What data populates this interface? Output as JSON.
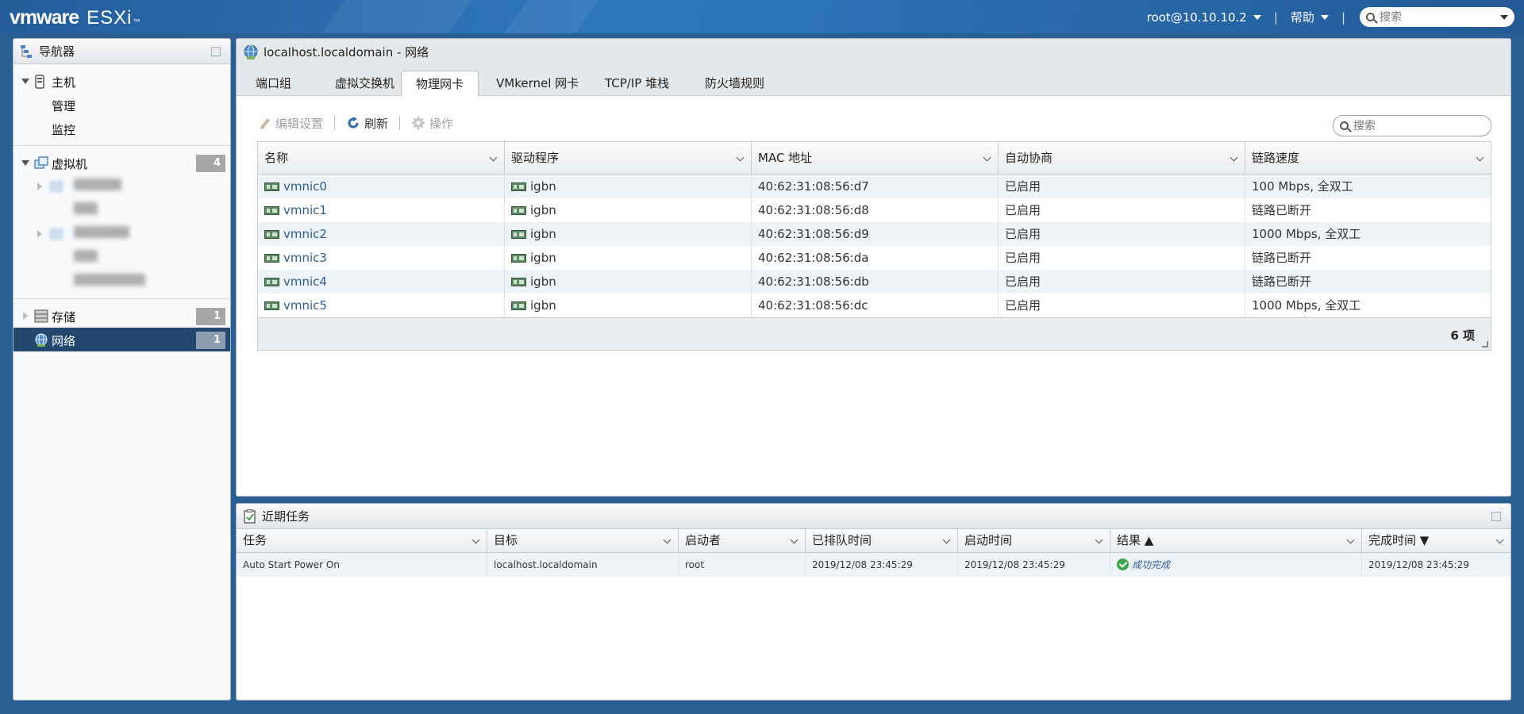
{
  "header": {
    "logo_vm": "vmware",
    "logo_product": "ESXi",
    "logo_tm": "™",
    "user": "root@10.10.10.2",
    "help": "帮助",
    "search_placeholder": "搜索"
  },
  "navigator": {
    "title": "导航器",
    "items": [
      {
        "label": "主机",
        "icon": "host-icon"
      },
      {
        "label": "管理"
      },
      {
        "label": "监控"
      },
      {
        "label": "虚拟机",
        "icon": "vm-icon",
        "badge": "4"
      },
      {
        "label": "存储",
        "icon": "storage-icon",
        "badge": "1"
      },
      {
        "label": "网络",
        "icon": "network-icon",
        "badge": "1"
      }
    ]
  },
  "main": {
    "title": "localhost.localdomain - 网络",
    "tabs": [
      "端口组",
      "虚拟交换机",
      "物理网卡",
      "VMkernel 网卡",
      "TCP/IP 堆栈",
      "防火墙规则"
    ],
    "active_tab": "物理网卡",
    "toolbar": {
      "edit": "编辑设置",
      "refresh": "刷新",
      "actions": "操作"
    },
    "search_placeholder": "搜索",
    "columns": [
      "名称",
      "驱动程序",
      "MAC 地址",
      "自动协商",
      "链路速度"
    ],
    "rows": [
      {
        "name": "vmnic0",
        "driver": "igbn",
        "mac": "40:62:31:08:56:d7",
        "auto": "已启用",
        "speed": "100 Mbps, 全双工"
      },
      {
        "name": "vmnic1",
        "driver": "igbn",
        "mac": "40:62:31:08:56:d8",
        "auto": "已启用",
        "speed": "链路已断开"
      },
      {
        "name": "vmnic2",
        "driver": "igbn",
        "mac": "40:62:31:08:56:d9",
        "auto": "已启用",
        "speed": "1000 Mbps, 全双工"
      },
      {
        "name": "vmnic3",
        "driver": "igbn",
        "mac": "40:62:31:08:56:da",
        "auto": "已启用",
        "speed": "链路已断开"
      },
      {
        "name": "vmnic4",
        "driver": "igbn",
        "mac": "40:62:31:08:56:db",
        "auto": "已启用",
        "speed": "链路已断开"
      },
      {
        "name": "vmnic5",
        "driver": "igbn",
        "mac": "40:62:31:08:56:dc",
        "auto": "已启用",
        "speed": "1000 Mbps, 全双工"
      }
    ],
    "item_count": "6 项"
  },
  "tasks": {
    "title": "近期任务",
    "columns": [
      "任务",
      "目标",
      "启动者",
      "已排队时间",
      "启动时间",
      "结果 ▲",
      "完成时间 ▼"
    ],
    "rows": [
      {
        "task": "Auto Start Power On",
        "target": "localhost.localdomain",
        "initiator": "root",
        "queued": "2019/12/08 23:45:29",
        "started": "2019/12/08 23:45:29",
        "result": "成功完成",
        "completed": "2019/12/08 23:45:29"
      }
    ]
  }
}
